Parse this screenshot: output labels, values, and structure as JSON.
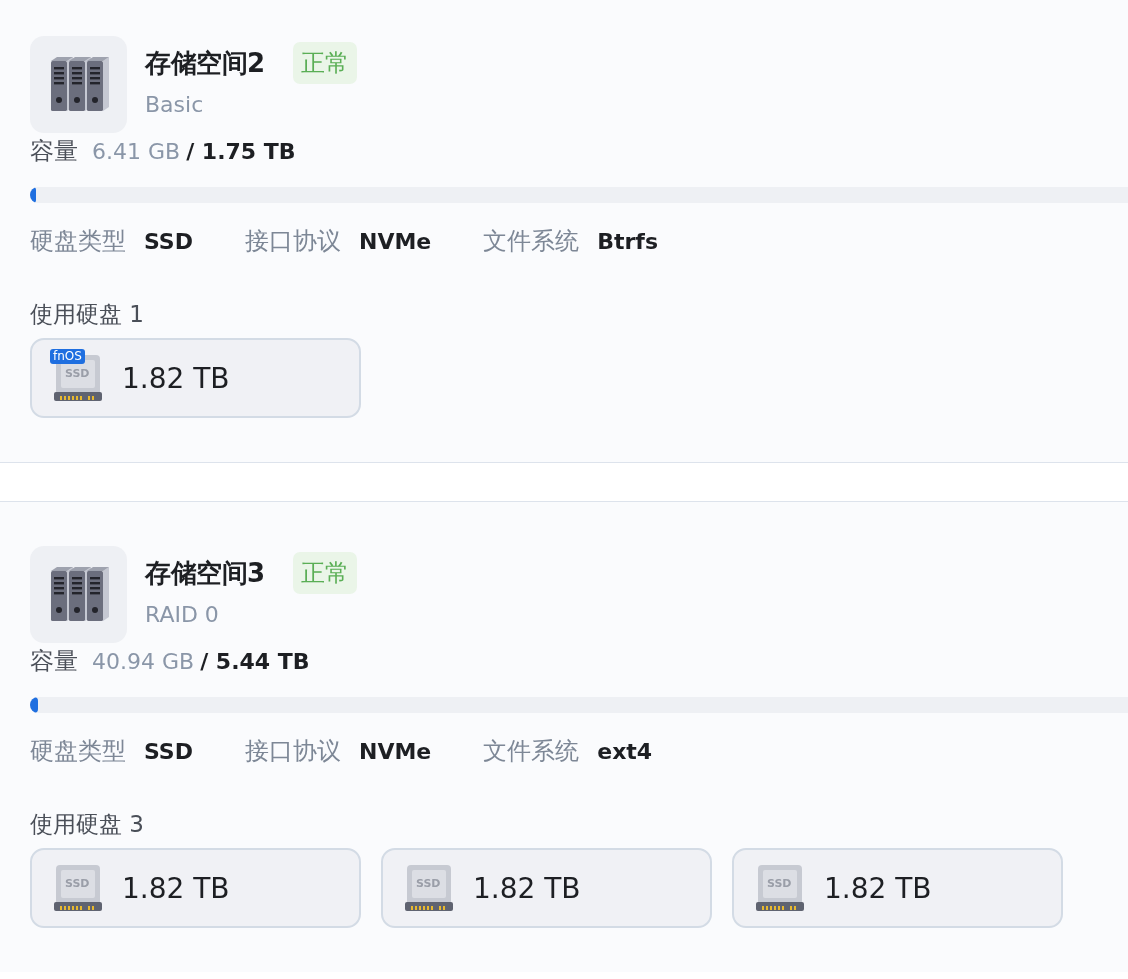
{
  "pools": [
    {
      "name": "存储空间2",
      "status": {
        "label": "正常",
        "kind": "normal"
      },
      "raid": "Basic",
      "capacity": {
        "label": "容量",
        "used": "6.41 GB",
        "total": "/ 1.75 TB",
        "level": 0.004
      },
      "properties": [
        {
          "label": "硬盘类型",
          "value": "SSD"
        },
        {
          "label": "接口协议",
          "value": "NVMe"
        },
        {
          "label": "文件系统",
          "value": "Btrfs"
        }
      ],
      "disks_label": "使用硬盘",
      "disk_count": "1",
      "disks": [
        {
          "tag": "fnOS",
          "icon_label": "SSD",
          "size": "1.82 TB"
        }
      ]
    },
    {
      "name": "存储空间3",
      "status": {
        "label": "正常",
        "kind": "normal"
      },
      "raid": "RAID 0",
      "capacity": {
        "label": "容量",
        "used": "40.94 GB",
        "total": "/ 5.44 TB",
        "level": 0.0073
      },
      "properties": [
        {
          "label": "硬盘类型",
          "value": "SSD"
        },
        {
          "label": "接口协议",
          "value": "NVMe"
        },
        {
          "label": "文件系统",
          "value": "ext4"
        }
      ],
      "disks_label": "使用硬盘",
      "disk_count": "3",
      "disks": [
        {
          "icon_label": "SSD",
          "size": "1.82 TB"
        },
        {
          "icon_label": "SSD",
          "size": "1.82 TB"
        },
        {
          "icon_label": "SSD",
          "size": "1.82 TB"
        }
      ]
    }
  ]
}
